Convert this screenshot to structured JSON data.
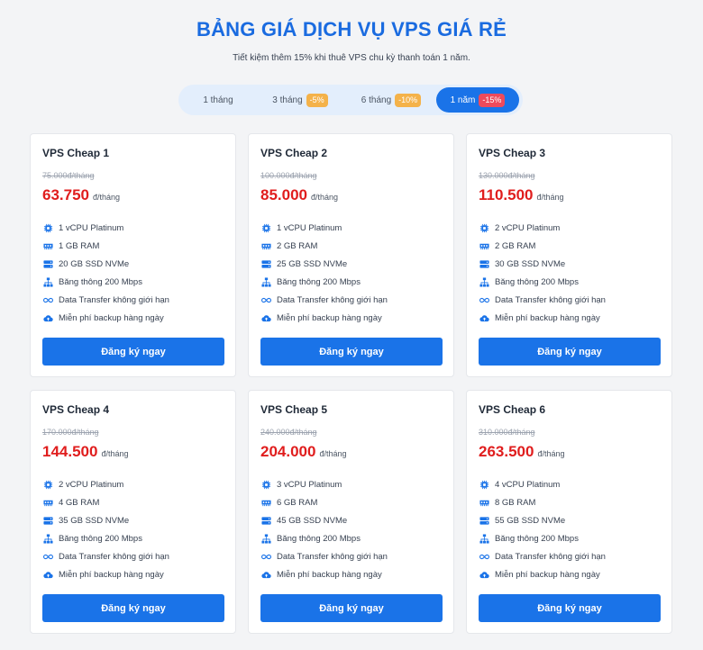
{
  "header": {
    "title": "BẢNG GIÁ DỊCH VỤ VPS GIÁ RẺ",
    "subtitle": "Tiết kiệm thêm 15% khi thuê VPS chu kỳ thanh toán 1 năm."
  },
  "billing_tabs": [
    {
      "label": "1 tháng",
      "badge": ""
    },
    {
      "label": "3 tháng",
      "badge": "-5%"
    },
    {
      "label": "6 tháng",
      "badge": "-10%"
    },
    {
      "label": "1 năm",
      "badge": "-15%",
      "selected": true
    }
  ],
  "colors": {
    "accent": "#1a73e8",
    "price": "#e01d1d",
    "title": "#1a6be0",
    "badge_yellow": "#f4b24a",
    "badge_red": "#ef4a5b"
  },
  "plans": [
    {
      "name": "VPS Cheap 1",
      "old_price": "75.000đ/tháng",
      "price": "63.750",
      "unit": "đ/tháng",
      "features": [
        "1 vCPU Platinum",
        "1 GB RAM",
        "20 GB SSD NVMe",
        "Băng thông 200 Mbps",
        "Data Transfer không giới hạn",
        "Miễn phí backup hàng ngày"
      ],
      "button": "Đăng ký ngay"
    },
    {
      "name": "VPS Cheap 2",
      "old_price": "100.000đ/tháng",
      "price": "85.000",
      "unit": "đ/tháng",
      "features": [
        "1 vCPU Platinum",
        "2 GB RAM",
        "25 GB SSD NVMe",
        "Băng thông 200 Mbps",
        "Data Transfer không giới hạn",
        "Miễn phí backup hàng ngày"
      ],
      "button": "Đăng ký ngay"
    },
    {
      "name": "VPS Cheap 3",
      "old_price": "130.000đ/tháng",
      "price": "110.500",
      "unit": "đ/tháng",
      "features": [
        "2 vCPU Platinum",
        "2 GB RAM",
        "30 GB SSD NVMe",
        "Băng thông 200 Mbps",
        "Data Transfer không giới hạn",
        "Miễn phí backup hàng ngày"
      ],
      "button": "Đăng ký ngay"
    },
    {
      "name": "VPS Cheap 4",
      "old_price": "170.000đ/tháng",
      "price": "144.500",
      "unit": "đ/tháng",
      "features": [
        "2 vCPU Platinum",
        "4 GB RAM",
        "35 GB SSD NVMe",
        "Băng thông 200 Mbps",
        "Data Transfer không giới hạn",
        "Miễn phí backup hàng ngày"
      ],
      "button": "Đăng ký ngay"
    },
    {
      "name": "VPS Cheap 5",
      "old_price": "240.000đ/tháng",
      "price": "204.000",
      "unit": "đ/tháng",
      "features": [
        "3 vCPU Platinum",
        "6 GB RAM",
        "45 GB SSD NVMe",
        "Băng thông 200 Mbps",
        "Data Transfer không giới hạn",
        "Miễn phí backup hàng ngày"
      ],
      "button": "Đăng ký ngay"
    },
    {
      "name": "VPS Cheap 6",
      "old_price": "310.000đ/tháng",
      "price": "263.500",
      "unit": "đ/tháng",
      "features": [
        "4 vCPU Platinum",
        "8 GB RAM",
        "55 GB SSD NVMe",
        "Băng thông 200 Mbps",
        "Data Transfer không giới hạn",
        "Miễn phí backup hàng ngày"
      ],
      "button": "Đăng ký ngay"
    }
  ],
  "feature_icons": [
    "cpu-icon",
    "ram-icon",
    "ssd-icon",
    "network-icon",
    "infinity-icon",
    "cloud-upload-icon"
  ]
}
